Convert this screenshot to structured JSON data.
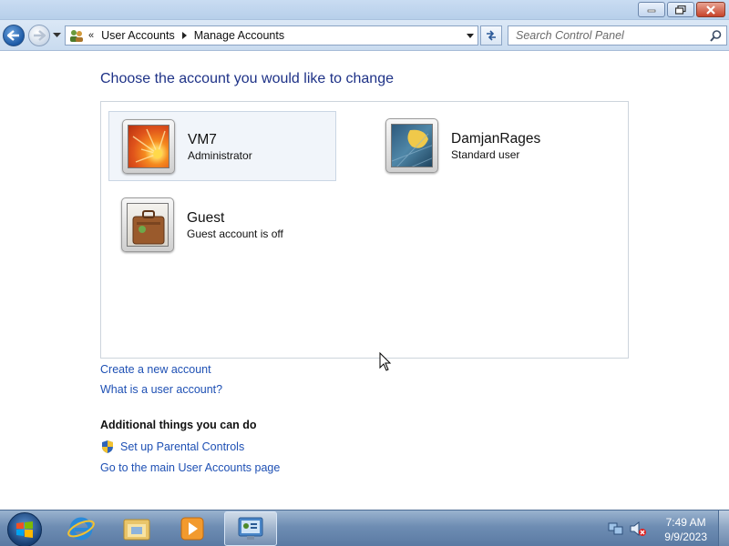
{
  "window": {
    "minimize_icon": "minimize-icon",
    "maximize_icon": "restore-icon",
    "close_icon": "close-icon"
  },
  "nav": {
    "breadcrumb": [
      {
        "label": "User Accounts"
      },
      {
        "label": "Manage Accounts"
      }
    ],
    "overflow_chevron": "«",
    "search_placeholder": "Search Control Panel"
  },
  "main": {
    "heading": "Choose the account you would like to change",
    "accounts": [
      {
        "name": "VM7",
        "type": "Administrator",
        "picture": "orange-flower-picture",
        "selected": true
      },
      {
        "name": "DamjanRages",
        "type": "Standard user",
        "picture": "leaf-picture",
        "selected": false
      },
      {
        "name": "Guest",
        "type": "Guest account is off",
        "picture": "suitcase-picture",
        "selected": false
      }
    ],
    "links": {
      "create_account": "Create a new account",
      "what_is_account": "What is a user account?"
    },
    "additional": {
      "heading": "Additional things you can do",
      "parental_controls": "Set up Parental Controls",
      "main_page": "Go to the main User Accounts page"
    }
  },
  "taskbar": {
    "items": [
      "start-orb",
      "internet-explorer",
      "windows-explorer",
      "windows-media-player",
      "control-panel"
    ],
    "active_item": "control-panel",
    "clock_time": "7:49 AM",
    "clock_date": "9/9/2023"
  },
  "colors": {
    "heading": "#1e3287",
    "link": "#1e50b4",
    "taskbar": "#6e8db3"
  }
}
